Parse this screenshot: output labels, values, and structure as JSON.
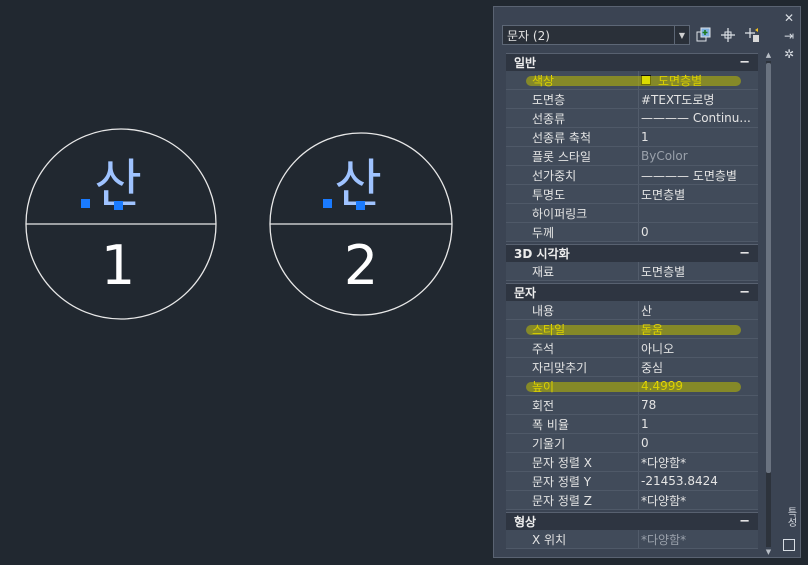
{
  "canvas": {
    "symbol_1": {
      "text": "산",
      "number": "1"
    },
    "symbol_2": {
      "text": "산",
      "number": "2"
    }
  },
  "panel": {
    "selector": {
      "value": "문자 (2)"
    },
    "side_label": "특성"
  },
  "sections": [
    {
      "title": "일반",
      "rows": [
        {
          "label": "색상",
          "value": "도면층별",
          "swatch": true,
          "highlight": true
        },
        {
          "label": "도면층",
          "value": "#TEXT도로명"
        },
        {
          "label": "선종류",
          "value": "———— Continu..."
        },
        {
          "label": "선종류 축척",
          "value": "1"
        },
        {
          "label": "플롯 스타일",
          "value": "ByColor",
          "dim": true
        },
        {
          "label": "선가중치",
          "value": "———— 도면층별"
        },
        {
          "label": "투명도",
          "value": "도면층별"
        },
        {
          "label": "하이퍼링크",
          "value": ""
        },
        {
          "label": "두께",
          "value": "0"
        }
      ]
    },
    {
      "title": "3D 시각화",
      "rows": [
        {
          "label": "재료",
          "value": "도면층별"
        }
      ]
    },
    {
      "title": "문자",
      "rows": [
        {
          "label": "내용",
          "value": "산"
        },
        {
          "label": "스타일",
          "value": "돋움",
          "highlight": true
        },
        {
          "label": "주석",
          "value": "아니오"
        },
        {
          "label": "자리맞추기",
          "value": "중심"
        },
        {
          "label": "높이",
          "value": "4.4999",
          "highlight": true
        },
        {
          "label": "회전",
          "value": "78"
        },
        {
          "label": "폭 비율",
          "value": "1"
        },
        {
          "label": "기울기",
          "value": "0"
        },
        {
          "label": "문자 정렬 X",
          "value": "*다양함*"
        },
        {
          "label": "문자 정렬 Y",
          "value": "-21453.8424"
        },
        {
          "label": "문자 정렬 Z",
          "value": "*다양함*"
        }
      ]
    },
    {
      "title": "형상",
      "rows": [
        {
          "label": "X 위치",
          "value": "*다양함*",
          "dim": true
        }
      ]
    }
  ],
  "colors": {
    "canvas_bg": "#212830",
    "highlight": "#ffe600",
    "swatch": "#ffff00",
    "text_symbol": "#9fc3ff",
    "grip": "#1a7bff"
  }
}
